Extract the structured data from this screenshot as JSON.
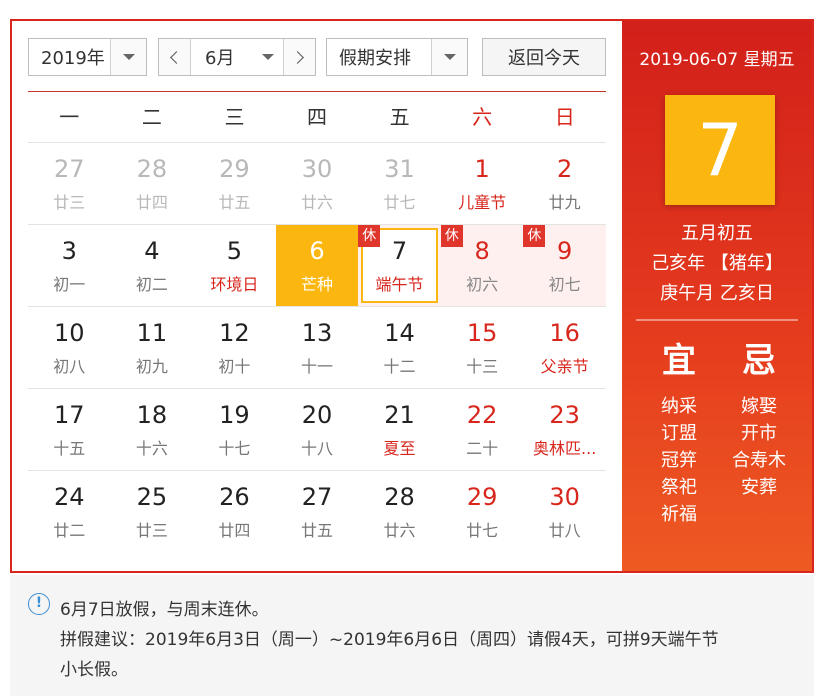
{
  "toolbar": {
    "year_label": "2019年",
    "month_label": "6月",
    "holiday_label": "假期安排",
    "today_label": "返回今天"
  },
  "weekdays": [
    "一",
    "二",
    "三",
    "四",
    "五",
    "六",
    "日"
  ],
  "weeks": [
    [
      {
        "day": "27",
        "sub": "廿三"
      },
      {
        "day": "28",
        "sub": "廿四"
      },
      {
        "day": "29",
        "sub": "廿五"
      },
      {
        "day": "30",
        "sub": "廿六"
      },
      {
        "day": "31",
        "sub": "廿七"
      },
      {
        "day": "1",
        "sub": "儿童节"
      },
      {
        "day": "2",
        "sub": "廿九"
      }
    ],
    [
      {
        "day": "3",
        "sub": "初一"
      },
      {
        "day": "4",
        "sub": "初二"
      },
      {
        "day": "5",
        "sub": "环境日"
      },
      {
        "day": "6",
        "sub": "芒种"
      },
      {
        "day": "7",
        "sub": "端午节",
        "badge": "休"
      },
      {
        "day": "8",
        "sub": "初六",
        "badge": "休"
      },
      {
        "day": "9",
        "sub": "初七",
        "badge": "休"
      }
    ],
    [
      {
        "day": "10",
        "sub": "初八"
      },
      {
        "day": "11",
        "sub": "初九"
      },
      {
        "day": "12",
        "sub": "初十"
      },
      {
        "day": "13",
        "sub": "十一"
      },
      {
        "day": "14",
        "sub": "十二"
      },
      {
        "day": "15",
        "sub": "十三"
      },
      {
        "day": "16",
        "sub": "父亲节"
      }
    ],
    [
      {
        "day": "17",
        "sub": "十五"
      },
      {
        "day": "18",
        "sub": "十六"
      },
      {
        "day": "19",
        "sub": "十七"
      },
      {
        "day": "20",
        "sub": "十八"
      },
      {
        "day": "21",
        "sub": "夏至"
      },
      {
        "day": "22",
        "sub": "二十"
      },
      {
        "day": "23",
        "sub": "奥林匹..."
      }
    ],
    [
      {
        "day": "24",
        "sub": "廿二"
      },
      {
        "day": "25",
        "sub": "廿三"
      },
      {
        "day": "26",
        "sub": "廿四"
      },
      {
        "day": "27",
        "sub": "廿五"
      },
      {
        "day": "28",
        "sub": "廿六"
      },
      {
        "day": "29",
        "sub": "廿七"
      },
      {
        "day": "30",
        "sub": "廿八"
      }
    ]
  ],
  "panel": {
    "date_line": "2019-06-07 星期五",
    "big_day": "7",
    "lunar": "五月初五",
    "ganzhi_year": "己亥年 【猪年】",
    "ganzhi_month_day": "庚午月 乙亥日",
    "yi_head": "宜",
    "ji_head": "忌",
    "yi_items": [
      "纳采",
      "订盟",
      "冠笄",
      "祭祀",
      "祈福"
    ],
    "ji_items": [
      "嫁娶",
      "开市",
      "合寿木",
      "安葬"
    ]
  },
  "notice": {
    "icon": "!",
    "line1": "6月7日放假，与周末连休。",
    "line2": "拼假建议：2019年6月3日（周一）~2019年6月6日（周四）请假4天，可拼9天端午节",
    "line3": "小长假。"
  },
  "colors": {
    "accent_red": "#d8261c",
    "today_yellow": "#fbb70f",
    "info_blue": "#3b8fd8"
  }
}
